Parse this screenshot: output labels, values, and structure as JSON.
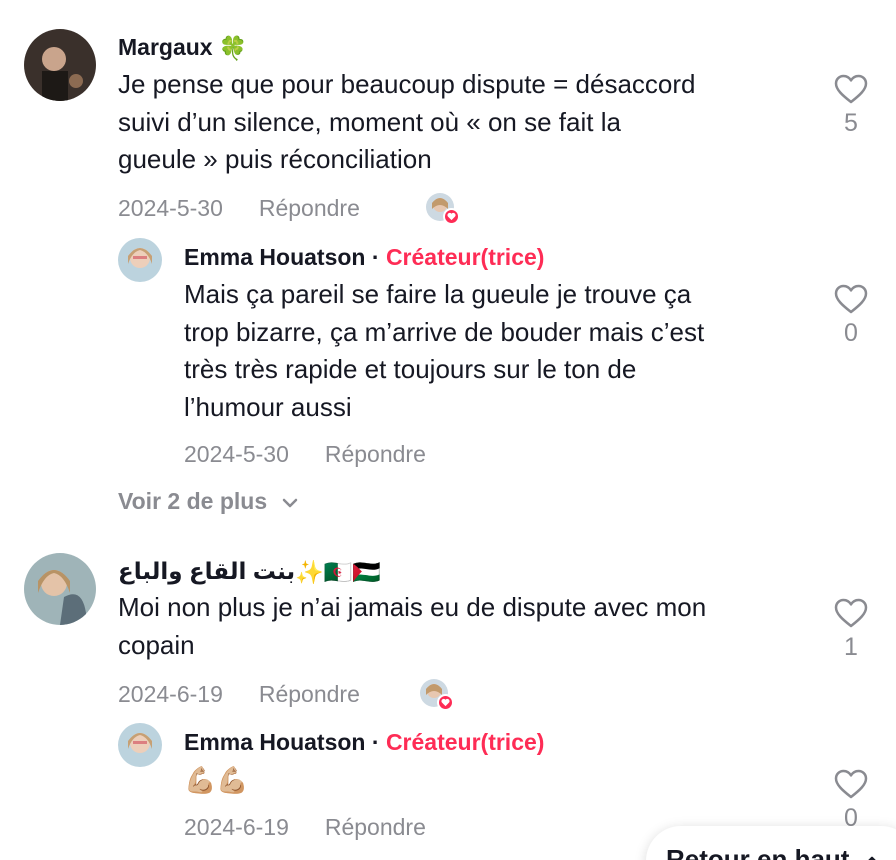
{
  "comments": [
    {
      "author": "Margaux",
      "author_emoji": "🍀",
      "text_lines": [
        "Je pense que pour beaucoup dispute = désaccord",
        "suivi d’un silence, moment où « on se fait la",
        "gueule » puis réconciliation"
      ],
      "date": "2024-5-30",
      "reply_label": "Répondre",
      "likes": "5",
      "reply": {
        "author": "Emma Houatson",
        "separator": "·",
        "badge": "Créateur(trice)",
        "text_lines": [
          "Mais ça pareil se faire la gueule je trouve ça",
          "trop bizarre, ça m’arrive de bouder mais c’est",
          "très très rapide et toujours sur le ton de",
          "l’humour aussi"
        ],
        "date": "2024-5-30",
        "reply_label": "Répondre",
        "likes": "0"
      },
      "more_label": "Voir 2 de plus"
    },
    {
      "author": "بنت القاع والباع",
      "author_emoji": "✨🇩🇿🇵🇸",
      "text_lines": [
        "Moi non plus je n’ai jamais eu de dispute avec mon",
        "copain"
      ],
      "date": "2024-6-19",
      "reply_label": "Répondre",
      "likes": "1",
      "reply": {
        "author": "Emma Houatson",
        "separator": "·",
        "badge": "Créateur(trice)",
        "text": "💪🏼💪🏼",
        "date": "2024-6-19",
        "reply_label": "Répondre",
        "likes": "0"
      }
    }
  ],
  "back_to_top": "Retour en haut",
  "colors": {
    "creator": "#fe2c55",
    "muted": "#8a8b91",
    "text": "#161823"
  }
}
